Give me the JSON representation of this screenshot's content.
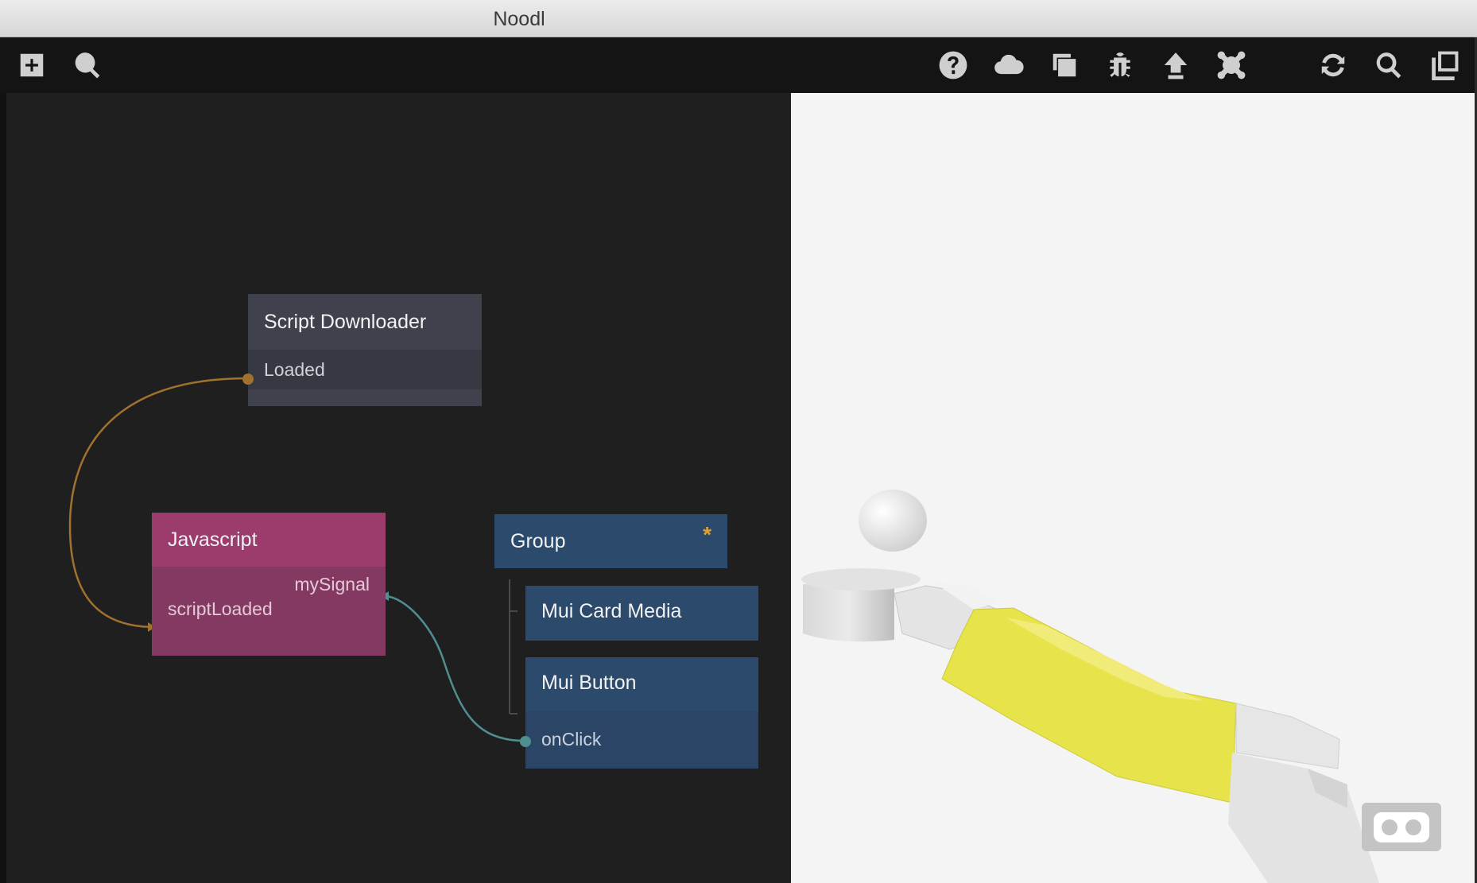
{
  "window": {
    "title": "Noodl"
  },
  "toolbar": {
    "left_icons": [
      "add-node-icon",
      "search-icon"
    ],
    "right_icons": [
      "help-icon",
      "cloud-icon",
      "windows-icon",
      "bug-icon",
      "upload-icon",
      "connect-icon",
      "refresh-icon",
      "preview-search-icon",
      "popout-icon"
    ]
  },
  "nodes": {
    "script_downloader": {
      "title": "Script Downloader",
      "port": "Loaded"
    },
    "javascript": {
      "title": "Javascript",
      "port_out": "mySignal",
      "port_in": "scriptLoaded"
    },
    "group": {
      "title": "Group",
      "marker": "*"
    },
    "card_media": {
      "title": "Mui Card Media"
    },
    "button": {
      "title": "Mui Button",
      "port": "onClick"
    }
  },
  "colors": {
    "editor_bg": "#1f1f1f",
    "node_dark": "#3f424c",
    "node_js": "#9b3c6c",
    "node_visual": "#2c4a6c",
    "wire_signal": "#a0722e",
    "wire_teal": "#4f8f91",
    "group_marker": "#e0a132"
  },
  "preview": {
    "vr_icon": "vr-headset-icon"
  }
}
